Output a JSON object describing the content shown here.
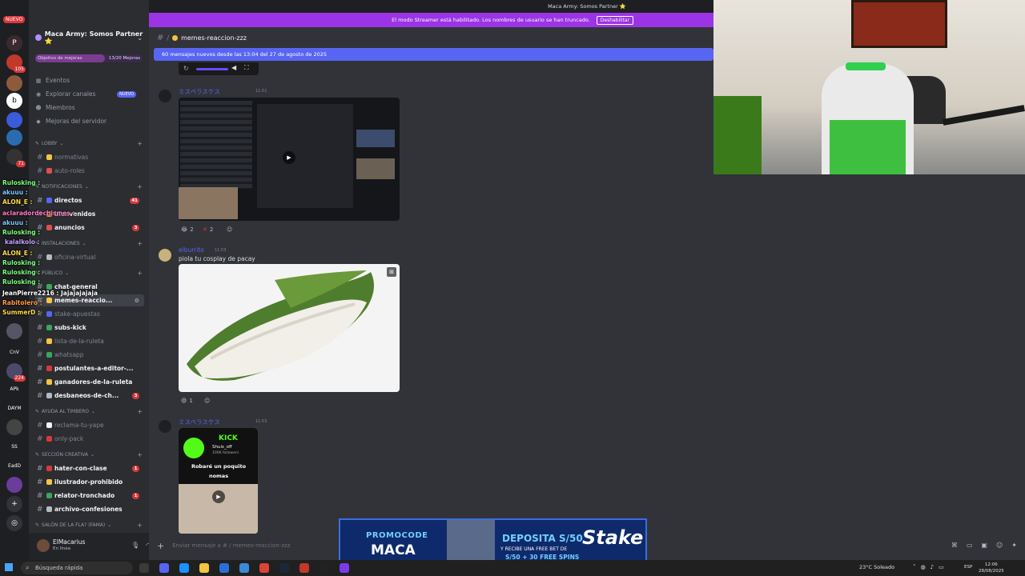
{
  "window": {
    "title": "Maca Army: Somos Partner ⭐"
  },
  "streamer_bar": {
    "text": "El modo Streamer está habilitado. Los nombres de usuario se han truncado.",
    "button": "Deshabilitar"
  },
  "server": {
    "name": "Maca Army: Somos Partner ⭐",
    "boost_goal": "Objetivo de mejoras",
    "boost_count": "13/20 Mejoras",
    "boost_progress": 0.65
  },
  "nav": {
    "events": "Eventos",
    "explore": "Explorar canales",
    "explore_badge": "NUEVO",
    "members": "Miembros",
    "server_boosts": "Mejoras del servidor"
  },
  "categories": {
    "lobby": "LOBBY",
    "notificaciones": "NOTIFICACIONES",
    "instalaciones": "INSTALACIONES",
    "publico": "PÚBLICO",
    "ayuda": "AYUDA AL TIMBERO",
    "creativa": "SECCIÓN CREATIVA",
    "salon": "SALÓN DE LA FLA? (FAMA)"
  },
  "channels": [
    {
      "label": "normativas",
      "unread": false
    },
    {
      "label": "auto-roles",
      "unread": false
    },
    {
      "label": "directos",
      "unread": true,
      "count": "41"
    },
    {
      "label": "bienvenidos",
      "unread": true
    },
    {
      "label": "anuncios",
      "unread": true,
      "count": "3"
    },
    {
      "label": "oficina-virtual",
      "unread": false
    },
    {
      "label": "chat-general",
      "unread": true
    },
    {
      "label": "memes-reaccio...",
      "unread": true,
      "active": true
    },
    {
      "label": "stake-apuestas",
      "unread": false
    },
    {
      "label": "subs-kick",
      "unread": true
    },
    {
      "label": "lista-de-la-ruleta",
      "unread": false
    },
    {
      "label": "whatsapp",
      "unread": false
    },
    {
      "label": "postulantes-a-editor-...",
      "unread": true
    },
    {
      "label": "ganadores-de-la-ruleta",
      "unread": true
    },
    {
      "label": "desbaneos-de-ch...",
      "unread": true,
      "count": "3"
    },
    {
      "label": "reclama-tu-yape",
      "unread": false
    },
    {
      "label": "only-pack",
      "unread": false
    },
    {
      "label": "hater-con-clase",
      "unread": true,
      "count": "1"
    },
    {
      "label": "ilustrador-prohibido",
      "unread": true
    },
    {
      "label": "relator-tronchado",
      "unread": true,
      "count": "1"
    },
    {
      "label": "archivo-confesiones",
      "unread": true
    }
  ],
  "user": {
    "name": "ElMacarius",
    "status": "En línea"
  },
  "channel_header": {
    "name": "memes-reaccion-zzz"
  },
  "new_messages": "60 mensajes nuevos desde las 13:04 del 27 de agosto de 2025",
  "messages": [
    {
      "author": "ミスペラスケス",
      "time": "11:51",
      "react1": "2",
      "react2": "2"
    },
    {
      "author": "elburrito",
      "time": "11:53",
      "text": "piola tu cosplay de pacay",
      "react1": "1"
    },
    {
      "author": "ミスペラスケス",
      "time": "11:53",
      "kick_label": "KICK",
      "kick_user": "Shuis_off",
      "kick_followers": "100K followers",
      "kick_caption": "Robaré un poquito nomas"
    }
  ],
  "composer": {
    "placeholder": "Enviar mensaje a # / memes-reaccion-zzz"
  },
  "overlay_chat": [
    {
      "name": "Rulosking :",
      "color": "#7cff7c"
    },
    {
      "name": "akuuu :",
      "color": "#7cc8ff"
    },
    {
      "name": "ALON_E :",
      "color": "#ffd84a"
    },
    {
      "name": "aclaradordechismes :",
      "color": "#ff7ac8"
    },
    {
      "name": "akuuu :",
      "color": "#7cc8ff"
    },
    {
      "name": "Rulosking :",
      "color": "#7cff7c"
    },
    {
      "name": "kalalkolo :",
      "color": "#c8a0ff"
    },
    {
      "name": "ALON_E :",
      "color": "#ffd84a"
    },
    {
      "name": "Rulosking :",
      "color": "#7cff7c"
    },
    {
      "name": "Rulosking :",
      "color": "#7cff7c"
    },
    {
      "name": "Rulosking :",
      "color": "#7cff7c"
    },
    {
      "name": "JeanPierre2216 : Jajajajajaja",
      "color": "#ffffff"
    },
    {
      "name": "Rabitolero :",
      "color": "#ff9a4a"
    },
    {
      "name": "SummerD :",
      "color": "#ffd84a"
    }
  ],
  "rail_labels": {
    "new": "NUEVO",
    "apk": "APk",
    "daym": "DAYM",
    "ss": "SS",
    "eadd": "EadD",
    "cn": "CnV"
  },
  "ad": {
    "promo_line1": "PROMOCODE",
    "promo_line2": "MACA",
    "deposit_line1": "DEPOSITA S/50",
    "deposit_line2": "Y RECIBE UNA FREE BET DE",
    "deposit_line3": "S/50 + 30 FREE SPINS",
    "brand": "Stake"
  },
  "taskbar": {
    "search": "Búsqueda rápida",
    "weather": "23°C Soleado",
    "lang": "ESP",
    "time": "12:06",
    "date": "28/08/2025"
  },
  "colors": {
    "accent": "#5865f2",
    "streamer": "#9b34e6",
    "danger": "#da373c"
  }
}
